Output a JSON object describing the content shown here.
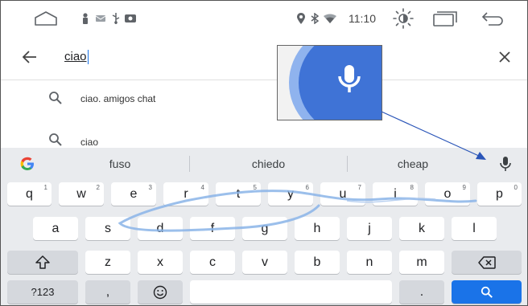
{
  "status_bar": {
    "time": "11:10"
  },
  "search": {
    "query": "ciao"
  },
  "suggestions": [
    {
      "text": "ciao. amigos chat"
    },
    {
      "text": "ciao"
    }
  ],
  "keyboard": {
    "strip_words": [
      "fuso",
      "chiedo",
      "cheap"
    ],
    "row1": [
      {
        "label": "q",
        "hint": "1"
      },
      {
        "label": "w",
        "hint": "2"
      },
      {
        "label": "e",
        "hint": "3"
      },
      {
        "label": "r",
        "hint": "4"
      },
      {
        "label": "t",
        "hint": "5"
      },
      {
        "label": "y",
        "hint": "6"
      },
      {
        "label": "u",
        "hint": "7"
      },
      {
        "label": "i",
        "hint": "8"
      },
      {
        "label": "o",
        "hint": "9"
      },
      {
        "label": "p",
        "hint": "0"
      }
    ],
    "row2": [
      "a",
      "s",
      "d",
      "f",
      "g",
      "h",
      "j",
      "k",
      "l"
    ],
    "row3": [
      "z",
      "x",
      "c",
      "v",
      "b",
      "n",
      "m"
    ],
    "symbols_key": "?123",
    "comma_key": ",",
    "period_key": "."
  },
  "colors": {
    "accent": "#1a73e8",
    "keyboard_bg": "#e9ebee",
    "glide_trail": "#8ab4e8"
  },
  "icons": {
    "home": "home-outline-icon",
    "back": "back-arrow-icon",
    "close": "close-x-icon",
    "search": "magnifier-icon",
    "mic": "microphone-icon",
    "shift": "shift-arrow-icon",
    "backspace": "backspace-icon",
    "emoji": "smiley-icon",
    "google": "google-g-icon"
  }
}
